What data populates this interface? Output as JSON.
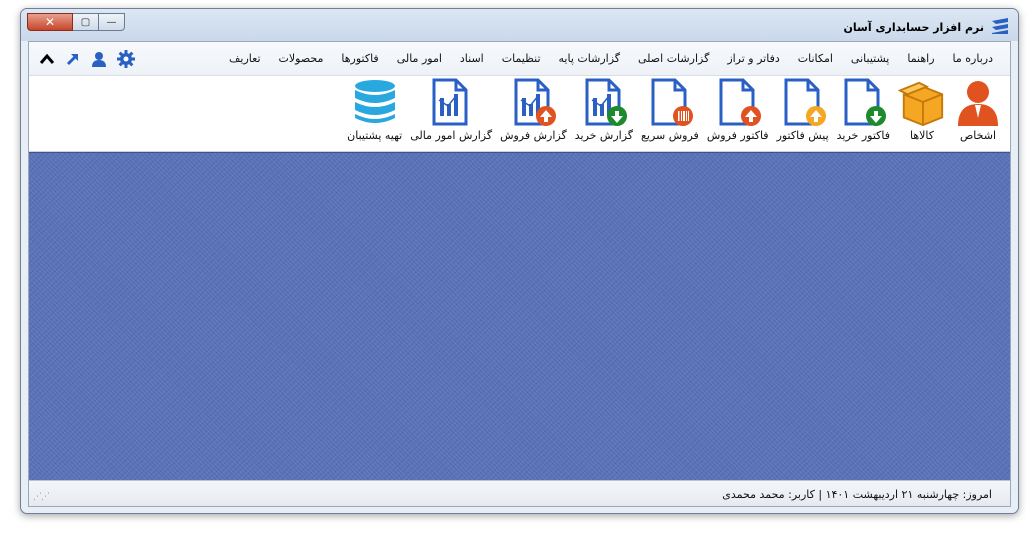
{
  "window": {
    "title": "نرم افزار حسابداری آسان",
    "close_label": "✕",
    "max_label": "▢",
    "min_label": "—"
  },
  "menu": [
    {
      "id": "tarifa",
      "label": "تعاریف"
    },
    {
      "id": "products",
      "label": "محصولات"
    },
    {
      "id": "invoices",
      "label": "فاکتورها"
    },
    {
      "id": "finance",
      "label": "امور مالی"
    },
    {
      "id": "documents",
      "label": "اسناد"
    },
    {
      "id": "settings",
      "label": "تنظیمات"
    },
    {
      "id": "base-reports",
      "label": "گزارشات پایه"
    },
    {
      "id": "main-reports",
      "label": "گزارشات اصلی"
    },
    {
      "id": "ledgers",
      "label": "دفاتر و تراز"
    },
    {
      "id": "facilities",
      "label": "امکانات"
    },
    {
      "id": "backup",
      "label": "پشتیبانی"
    },
    {
      "id": "help",
      "label": "راهنما"
    },
    {
      "id": "about",
      "label": "درباره ما"
    }
  ],
  "quick_icons": [
    "gear-icon",
    "user-icon",
    "arrow-up-right-icon",
    "chevron-up-icon"
  ],
  "toolbar": [
    {
      "id": "persons",
      "label": "اشخاص",
      "icon": "person-icon"
    },
    {
      "id": "goods",
      "label": "کالاها",
      "icon": "box-icon"
    },
    {
      "id": "purchase-invoice",
      "label": "فاکتور خرید",
      "icon": "doc-down-icon"
    },
    {
      "id": "pre-invoice",
      "label": "پیش فاکتور",
      "icon": "doc-up-orange-icon"
    },
    {
      "id": "sales-invoice",
      "label": "فاکتور فروش",
      "icon": "doc-up-red-icon"
    },
    {
      "id": "quick-sale",
      "label": "فروش سریع",
      "icon": "doc-barcode-icon"
    },
    {
      "id": "purchase-report",
      "label": "گزارش خرید",
      "icon": "chart-down-icon"
    },
    {
      "id": "sales-report",
      "label": "گزارش فروش",
      "icon": "chart-up-icon"
    },
    {
      "id": "finance-report",
      "label": "گزارش امور مالی",
      "icon": "chart-icon"
    },
    {
      "id": "make-backup",
      "label": "تهیه پشتیبان",
      "icon": "database-icon"
    }
  ],
  "status": {
    "text": "امروز: چهارشنبه ۲۱ اردیبهشت ۱۴۰۱   |   کاربر: محمد محمدی"
  },
  "colors": {
    "accent_blue": "#2a5fc4",
    "denim": "#5a72b8",
    "orange": "#f5a623",
    "red": "#e0521f",
    "green": "#1d8a2e"
  }
}
